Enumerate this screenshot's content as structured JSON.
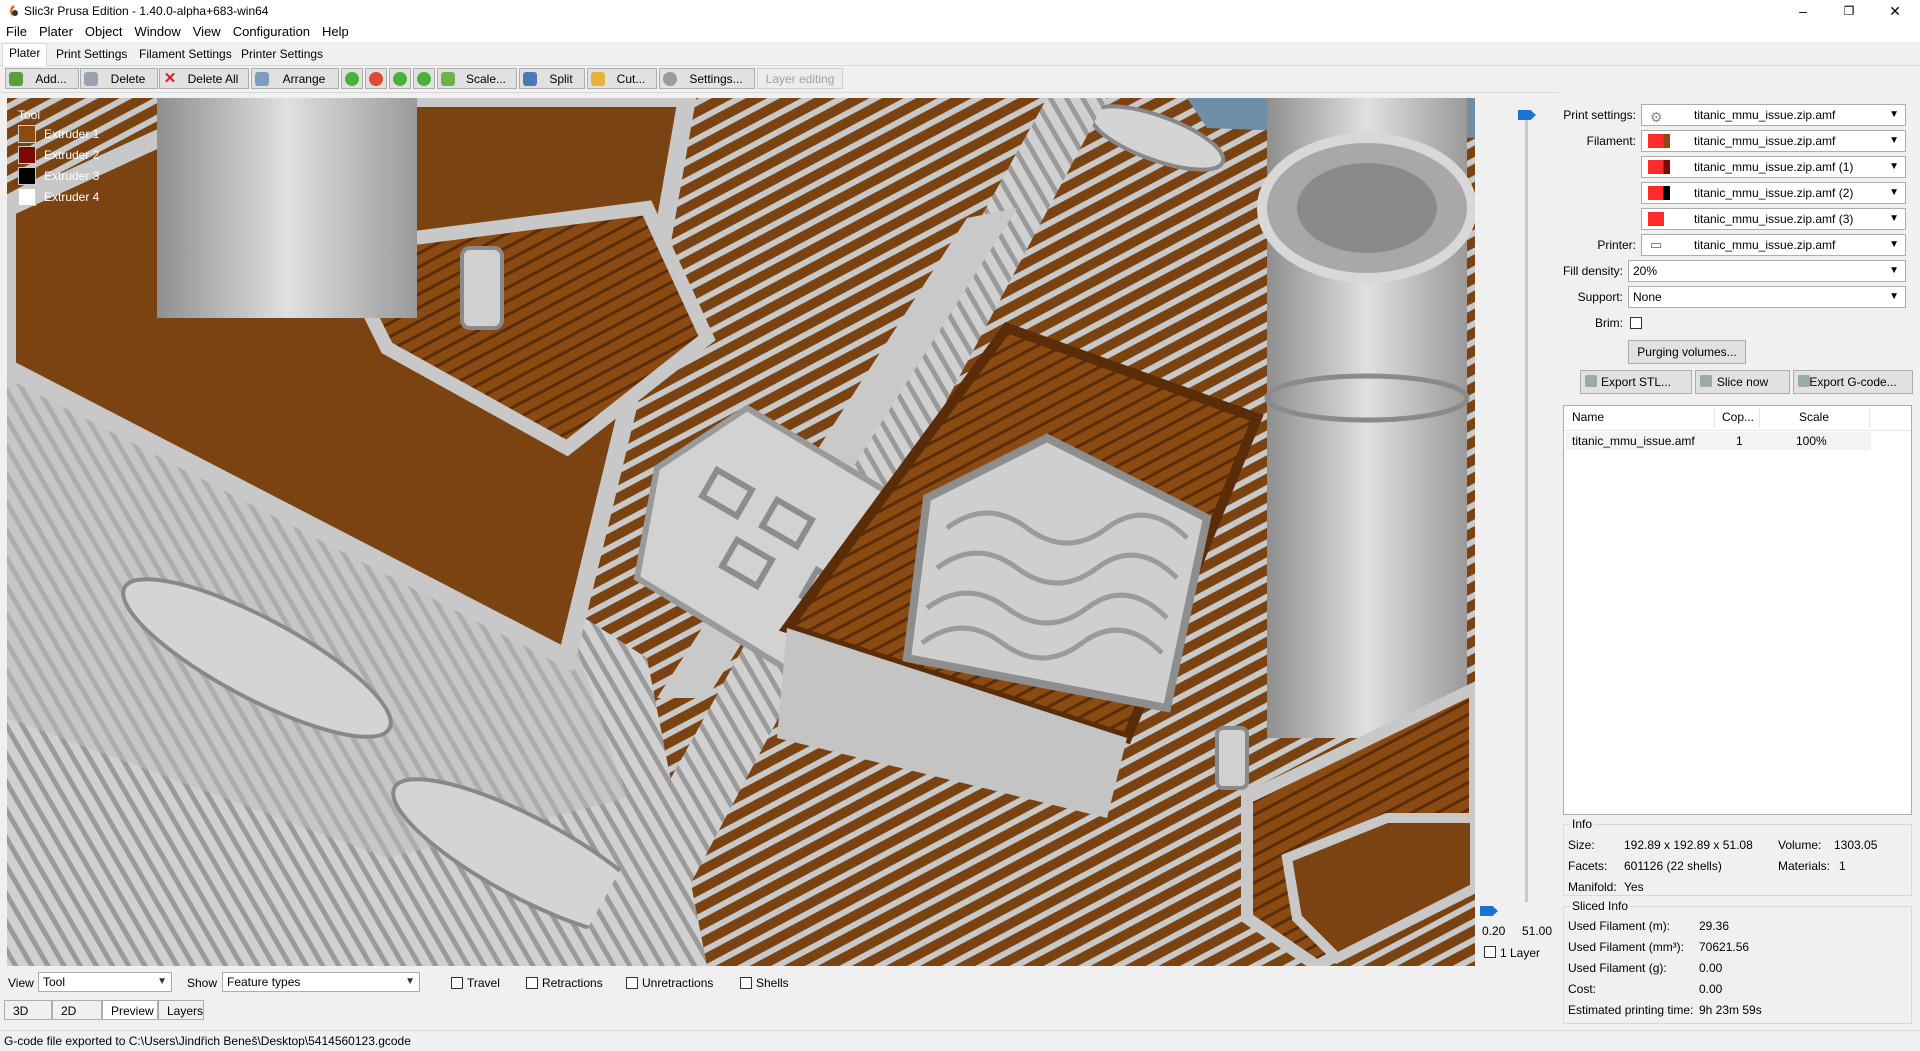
{
  "window": {
    "title": "Slic3r Prusa Edition - 1.40.0-alpha+683-win64",
    "minimize": "–",
    "maximize": "❐",
    "close": "✕"
  },
  "menu": [
    "File",
    "Plater",
    "Object",
    "Window",
    "View",
    "Configuration",
    "Help"
  ],
  "tabs": [
    "Plater",
    "Print Settings",
    "Filament Settings",
    "Printer Settings"
  ],
  "toolbar": {
    "add": "Add...",
    "delete": "Delete",
    "delete_all": "Delete All",
    "arrange": "Arrange",
    "scale": "Scale...",
    "split": "Split",
    "cut": "Cut...",
    "settings": "Settings...",
    "layer_editing": "Layer editing"
  },
  "legend": {
    "title": "Tool",
    "items": [
      {
        "label": "Extruder 1",
        "color": "#8a4a12"
      },
      {
        "label": "Extruder 2",
        "color": "#7a0a00"
      },
      {
        "label": "Extruder 3",
        "color": "#000000"
      },
      {
        "label": "Extruder 4",
        "color": "#ffffff"
      }
    ]
  },
  "layers": {
    "min": "0.20",
    "max": "51.00",
    "one_layer": "1 Layer"
  },
  "viewbar": {
    "view_label": "View",
    "view_value": "Tool",
    "show_label": "Show",
    "show_value": "Feature types",
    "travel": "Travel",
    "retractions": "Retractions",
    "unretractions": "Unretractions",
    "shells": "Shells"
  },
  "bottom_tabs": [
    "3D",
    "2D",
    "Preview",
    "Layers"
  ],
  "status": "G-code file exported to C:\\Users\\Jindřich Beneš\\Desktop\\5414560123.gcode",
  "panel": {
    "print_settings_label": "Print settings:",
    "print_settings_value": "titanic_mmu_issue.zip.amf",
    "filament_label": "Filament:",
    "filaments": [
      {
        "value": "titanic_mmu_issue.zip.amf",
        "c1": "#ff2a2a",
        "c2": "#8a4a12"
      },
      {
        "value": "titanic_mmu_issue.zip.amf (1)",
        "c1": "#ff2a2a",
        "c2": "#7a0a00"
      },
      {
        "value": "titanic_mmu_issue.zip.amf (2)",
        "c1": "#ff2a2a",
        "c2": "#000000"
      },
      {
        "value": "titanic_mmu_issue.zip.amf (3)",
        "c1": "#ff2a2a",
        "c2": "#ff2a2a"
      }
    ],
    "printer_label": "Printer:",
    "printer_value": "titanic_mmu_issue.zip.amf",
    "fill_density_label": "Fill density:",
    "fill_density_value": "20%",
    "support_label": "Support:",
    "support_value": "None",
    "brim_label": "Brim:",
    "purging": "Purging volumes...",
    "export_stl": "Export STL...",
    "slice_now": "Slice now",
    "export_gcode": "Export G-code..."
  },
  "object_list": {
    "columns": [
      "Name",
      "Cop...",
      "Scale"
    ],
    "rows": [
      {
        "name": "titanic_mmu_issue.amf",
        "copies": "1",
        "scale": "100%"
      }
    ]
  },
  "info": {
    "title": "Info",
    "size_label": "Size:",
    "size": "192.89 x 192.89 x 51.08",
    "volume_label": "Volume:",
    "volume": "1303.05",
    "facets_label": "Facets:",
    "facets": "601126 (22 shells)",
    "materials_label": "Materials:",
    "materials": "1",
    "manifold_label": "Manifold:",
    "manifold": "Yes"
  },
  "sliced": {
    "title": "Sliced Info",
    "filament_m_label": "Used Filament (m):",
    "filament_m": "29.36",
    "filament_mm3_label": "Used Filament (mm³):",
    "filament_mm3": "70621.56",
    "filament_g_label": "Used Filament (g):",
    "filament_g": "0.00",
    "cost_label": "Cost:",
    "cost": "0.00",
    "time_label": "Estimated printing time:",
    "time": "9h 23m 59s"
  }
}
